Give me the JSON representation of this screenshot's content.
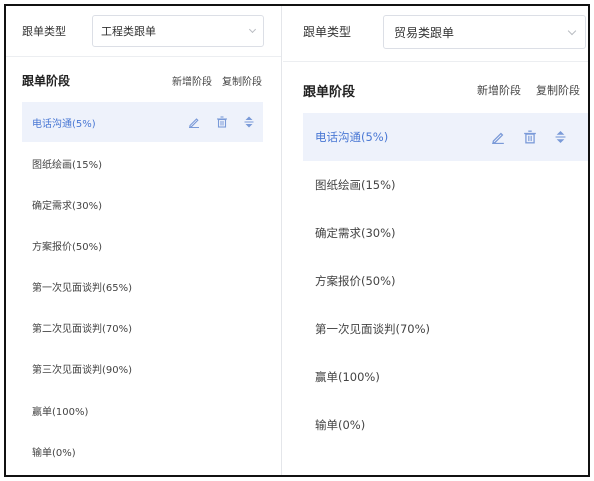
{
  "left_panel": {
    "type_label": "跟单类型",
    "type_select_value": "工程类跟单",
    "stages_title": "跟单阶段",
    "add_stage_label": "新增阶段",
    "copy_stage_label": "复制阶段",
    "stages": [
      {
        "label": "电话沟通(5%)",
        "active": true
      },
      {
        "label": "图纸绘画(15%)",
        "active": false
      },
      {
        "label": "确定需求(30%)",
        "active": false
      },
      {
        "label": "方案报价(50%)",
        "active": false
      },
      {
        "label": "第一次见面谈判(65%)",
        "active": false
      },
      {
        "label": "第二次见面谈判(70%)",
        "active": false
      },
      {
        "label": "第三次见面谈判(90%)",
        "active": false
      },
      {
        "label": "赢单(100%)",
        "active": false
      },
      {
        "label": "输单(0%)",
        "active": false
      }
    ]
  },
  "right_panel": {
    "type_label": "跟单类型",
    "type_select_value": "贸易类跟单",
    "stages_title": "跟单阶段",
    "add_stage_label": "新增阶段",
    "copy_stage_label": "复制阶段",
    "stages": [
      {
        "label": "电话沟通(5%)",
        "active": true
      },
      {
        "label": "图纸绘画(15%)",
        "active": false
      },
      {
        "label": "确定需求(30%)",
        "active": false
      },
      {
        "label": "方案报价(50%)",
        "active": false
      },
      {
        "label": "第一次见面谈判(70%)",
        "active": false
      },
      {
        "label": "赢单(100%)",
        "active": false
      },
      {
        "label": "输单(0%)",
        "active": false
      }
    ]
  },
  "colors": {
    "accent": "#4a78d4",
    "active_bg": "#eef2fb",
    "icon": "#7a9ad8",
    "text": "#444444",
    "border": "#dcdfe6"
  },
  "icons": {
    "edit": "pencil-icon",
    "delete": "trash-icon",
    "sort": "sort-icon",
    "dropdown": "chevron-down-icon"
  }
}
